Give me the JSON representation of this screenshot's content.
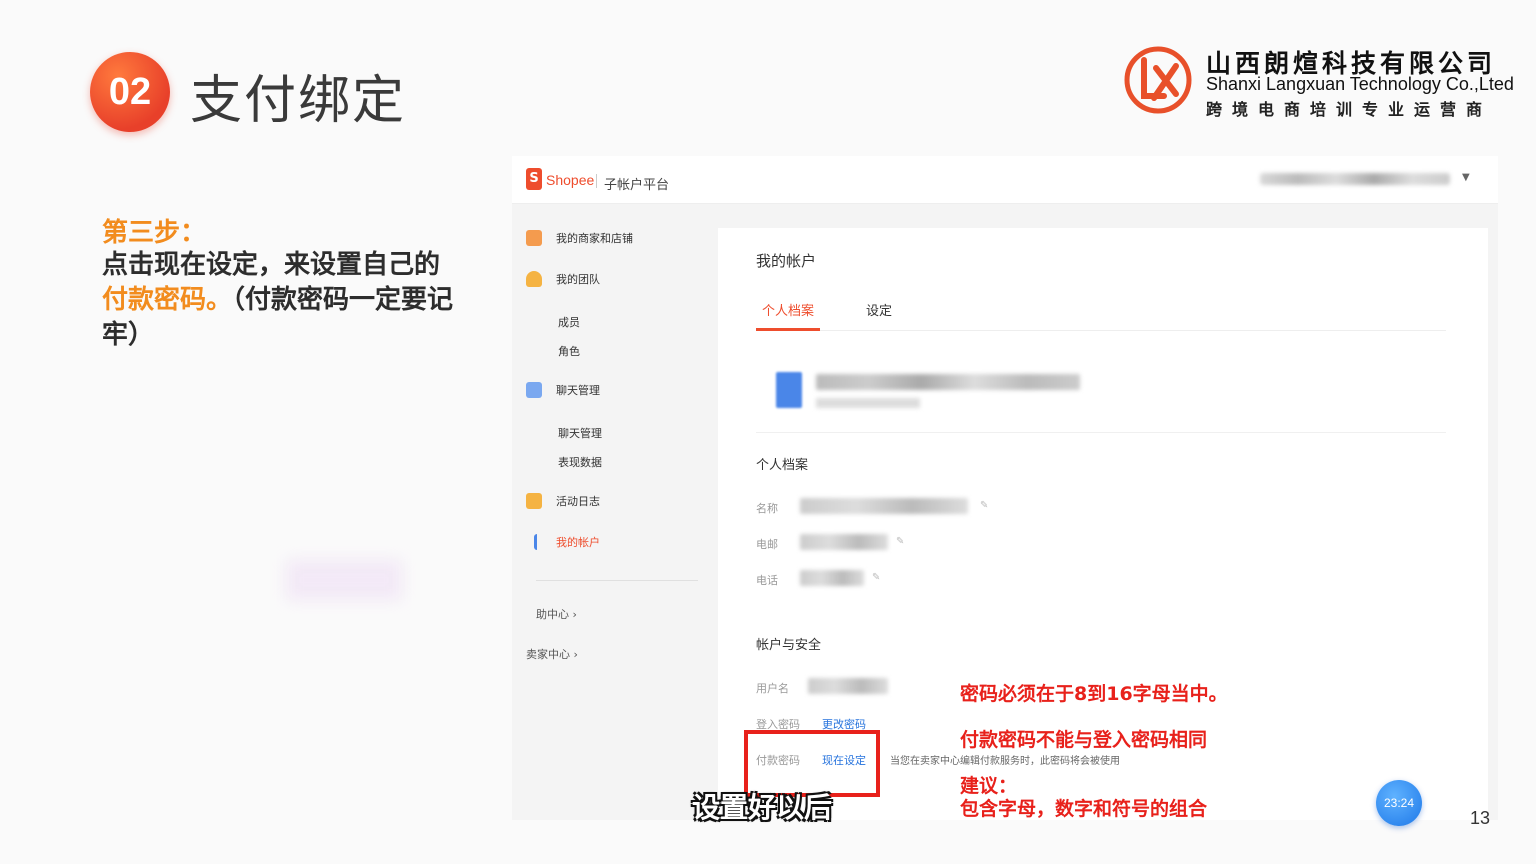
{
  "slide": {
    "number": "02",
    "title": "支付绑定",
    "page_number": "13"
  },
  "logo": {
    "cn": "山西朗煊科技有限公司",
    "en": "Shanxi Langxuan Technology Co.,Lted",
    "tagline": "跨境电商培训专业运营商",
    "mark_color": "#e8502a"
  },
  "step": {
    "label": "第三步：",
    "text_1": "点击现在设定，来设置自己的",
    "highlight": "付款密码。",
    "text_2": "（付款密码一定要记牢）"
  },
  "app": {
    "brand": "Shopee",
    "portal": "子帐户平台",
    "accent_color": "#ee4d2d",
    "sidebar": {
      "items": [
        {
          "label": "我的商家和店铺",
          "icon": "store-icon"
        },
        {
          "label": "我的团队",
          "icon": "team-icon"
        },
        {
          "label": "成员"
        },
        {
          "label": "角色"
        },
        {
          "label": "聊天管理",
          "icon": "chat-icon"
        },
        {
          "label": "聊天管理"
        },
        {
          "label": "表现数据"
        },
        {
          "label": "活动日志",
          "icon": "log-icon"
        },
        {
          "label": "我的帐户",
          "icon": "account-icon"
        }
      ],
      "help_center": "助中心",
      "seller_center": "卖家中心"
    },
    "main": {
      "title": "我的帐户",
      "tabs": [
        "个人档案",
        "设定"
      ],
      "profile_section": "个人档案",
      "fields": {
        "name_label": "名称",
        "email_label": "电邮",
        "phone_label": "电话"
      },
      "security_section": "帐户与安全",
      "security": {
        "username_label": "用户名",
        "login_pw_label": "登入密码",
        "login_pw_link": "更改密码",
        "pay_pw_label": "付款密码",
        "pay_pw_link": "现在设定",
        "pay_pw_note": "当您在卖家中心编辑付款服务时，此密码将会被使用"
      }
    }
  },
  "annotations": {
    "rule_1": "密码必须在于8到16字母当中。",
    "rule_2": "付款密码不能与登入密码相同",
    "suggest_label": "建议：",
    "suggest_text": "包含字母，数字和符号的组合"
  },
  "subtitle": "设置好以后",
  "timer": "23:24"
}
